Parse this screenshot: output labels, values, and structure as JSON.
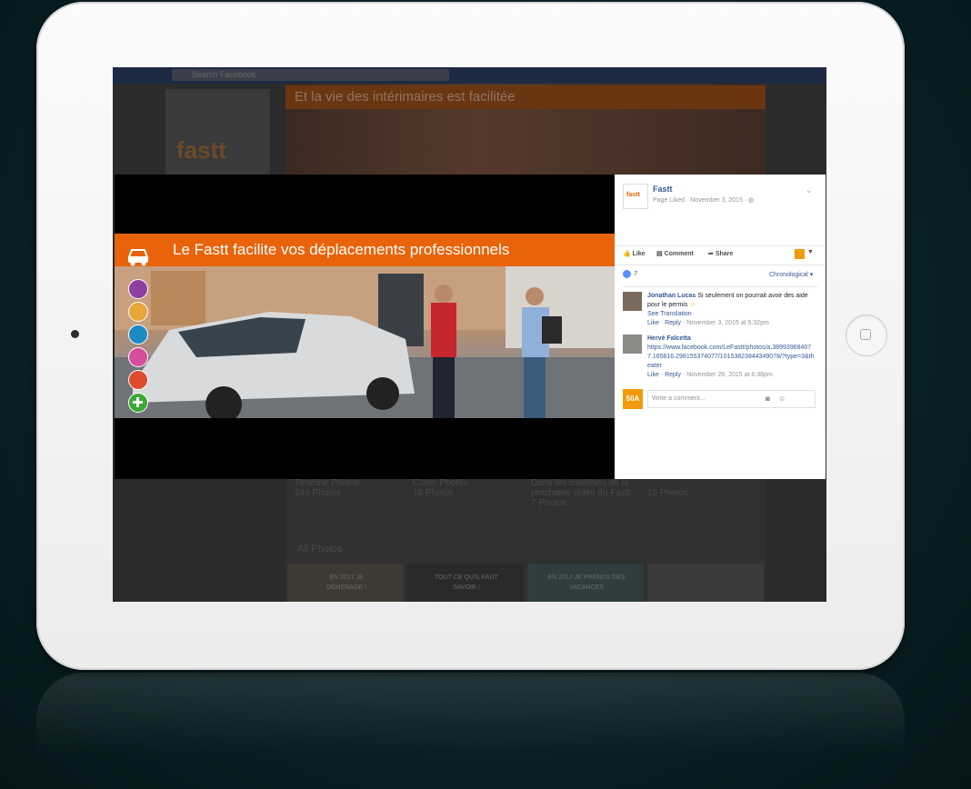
{
  "background_page": {
    "search_placeholder": "Search Facebook",
    "banner": "Et la vie des intérimaires est facilitée",
    "logo_text": "fastt",
    "albums": [
      {
        "name": "Timeline Photos",
        "count": "246 Photos"
      },
      {
        "name": "Cover Photos",
        "count": "10 Photos"
      },
      {
        "name": "Dans les coulisses de la prochaine vidéo du Fastt",
        "count": "7 Photos"
      },
      {
        "name": "",
        "count": "15 Photos"
      }
    ],
    "all_photos": "All Photos",
    "thumbs": [
      "EN 2017 JE DÉMÉNAGE !",
      "TOUT CE QU'IL FAUT SAVOIR !",
      "EN 2017 JE PRENDS DES VACANCES",
      ""
    ]
  },
  "lightbox": {
    "banner_title": "Le Fastt facilite vos déplacements professionnels",
    "side_icons": [
      {
        "name": "piggy-bank-icon",
        "color": "#8e3fa0"
      },
      {
        "name": "key-icon",
        "color": "#e8a53a"
      },
      {
        "name": "house-icon",
        "color": "#1d8ac6"
      },
      {
        "name": "rocking-horse-icon",
        "color": "#d64e9b"
      },
      {
        "name": "people-icon",
        "color": "#e04a2e"
      },
      {
        "name": "plus-icon",
        "color": "#3aaa35"
      }
    ]
  },
  "post": {
    "page_name": "Fastt",
    "logo_text": "fastt",
    "meta": "Page Liked · November 3, 2015 · ",
    "actions": {
      "like": "Like",
      "comment": "Comment",
      "share": "Share"
    },
    "reaction_count": "7",
    "sort": "Chronological",
    "comments": [
      {
        "author": "Jonathan Lucas",
        "text": "Si seulement on pourrait avoir des aide pour le permis",
        "see_translation": "See Translation",
        "like": "Like",
        "reply": "Reply",
        "date": "November 3, 2015 at 5:32pm"
      },
      {
        "author": "Hervé Falcetta",
        "link": "https://www.facebook.com/LeFastt/photos/a.389939684077.165616.298155374077/10153823844349078/?type=3&theater",
        "like": "Like",
        "reply": "Reply",
        "date": "November 26, 2015 at 6:38pm"
      }
    ],
    "write_placeholder": "Write a comment...",
    "my_avatar_text": "50A"
  },
  "colors": {
    "fastt_orange": "#e8630a",
    "fb_blue": "#365899"
  }
}
